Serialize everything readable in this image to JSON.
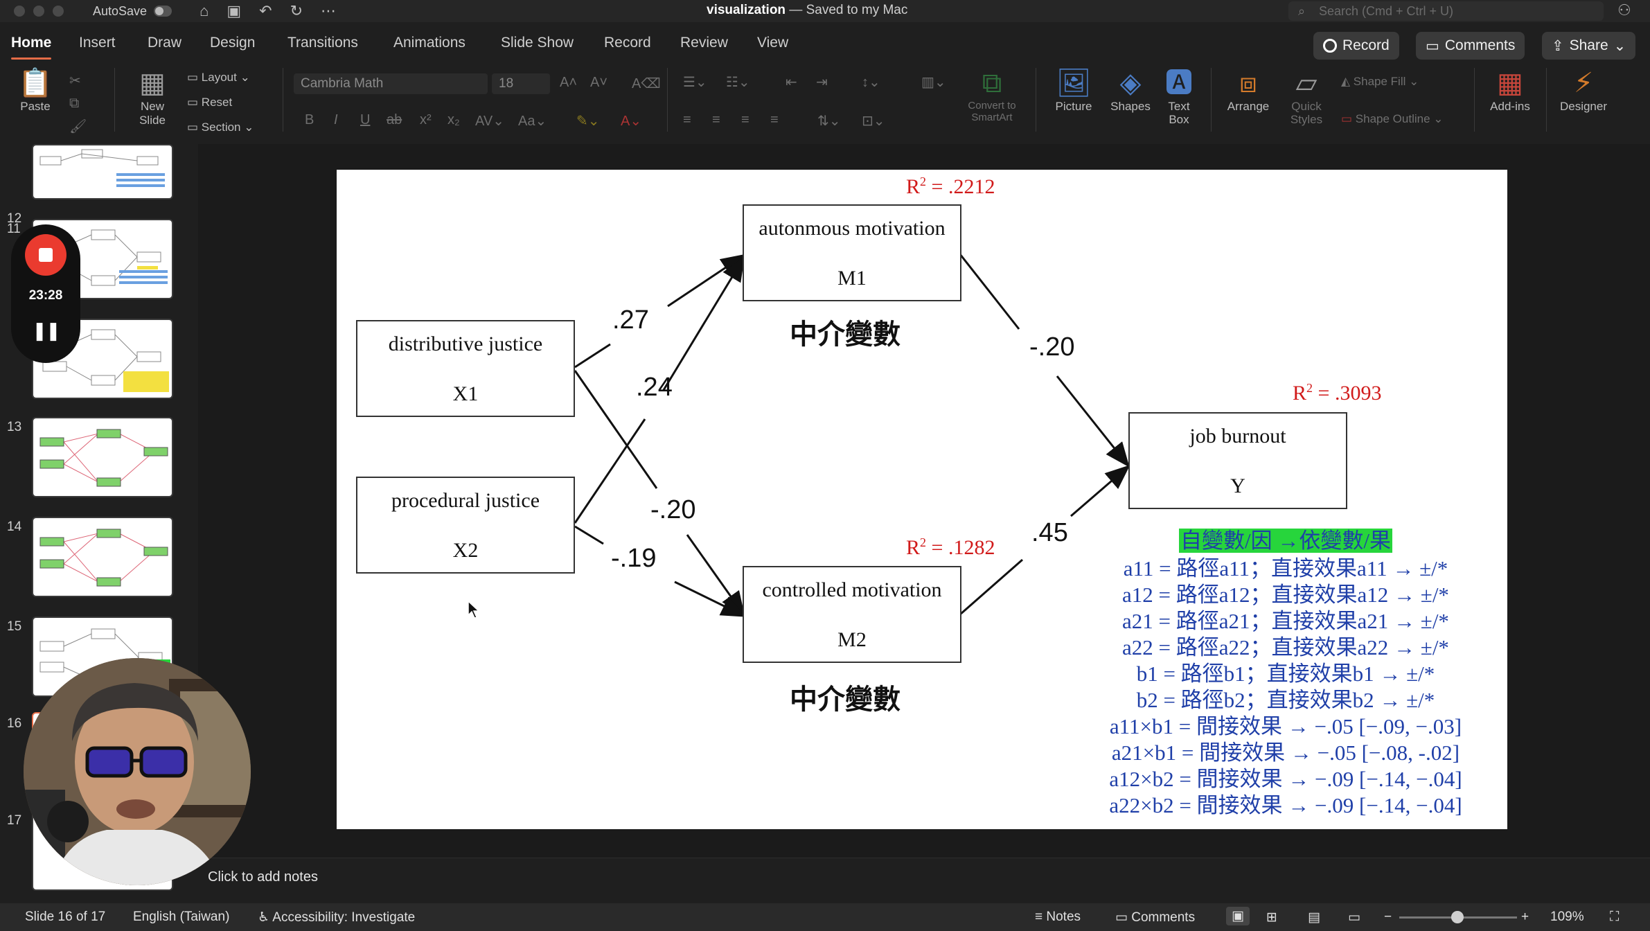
{
  "titlebar": {
    "autosave_label": "AutoSave",
    "doc_name": "visualization",
    "doc_status": "— Saved to my Mac",
    "search_placeholder": "Search (Cmd + Ctrl + U)"
  },
  "tabs": [
    "Home",
    "Insert",
    "Draw",
    "Design",
    "Transitions",
    "Animations",
    "Slide Show",
    "Record",
    "Review",
    "View"
  ],
  "actions": {
    "record": "Record",
    "comments": "Comments",
    "share": "Share"
  },
  "ribbon": {
    "paste": "Paste",
    "new_slide": "New Slide",
    "layout": "Layout",
    "reset": "Reset",
    "section": "Section",
    "font_name": "Cambria Math",
    "font_size": "18",
    "convert_smartart": "Convert to SmartArt",
    "picture": "Picture",
    "shapes": "Shapes",
    "text_box": "Text Box",
    "arrange": "Arrange",
    "quick_styles": "Quick Styles",
    "shape_fill": "Shape Fill",
    "shape_outline": "Shape Outline",
    "add_ins": "Add-ins",
    "designer": "Designer"
  },
  "thumbnails": [
    "11",
    "12",
    "13",
    "14",
    "15",
    "16",
    "17"
  ],
  "recording": {
    "elapsed": "23:28"
  },
  "slide": {
    "boxes": {
      "x1": {
        "label": "distributive justice",
        "var": "X1"
      },
      "x2": {
        "label": "procedural justice",
        "var": "X2"
      },
      "m1": {
        "label": "autonmous motivation",
        "var": "M1"
      },
      "m2": {
        "label": "controlled motivation",
        "var": "M2"
      },
      "y": {
        "label": "job burnout",
        "var": "Y"
      }
    },
    "coefficients": {
      "a11": ".27",
      "a21": ".24",
      "a12": "-.20",
      "a22": "-.19",
      "b1": "-.20",
      "b2": ".45"
    },
    "r2": {
      "m1": ".2212",
      "m2": ".1282",
      "y": ".3093"
    },
    "r2_prefix": "R",
    "r2_sup": "2",
    "r2_eq": " = ",
    "mediator_label": "中介變數",
    "legend": {
      "header": "自變數/因 →依變數/果",
      "lines": [
        "a11 = 路徑a11；直接效果a11 → ±/*",
        "a12 = 路徑a12；直接效果a12 → ±/*",
        "a21 = 路徑a21；直接效果a21 → ±/*",
        "a22 = 路徑a22；直接效果a22 → ±/*",
        "b1 = 路徑b1；直接效果b1 → ±/*",
        "b2 = 路徑b2；直接效果b2 → ±/*",
        "a11×b1 = 間接效果 → −.05 [−.09, −.03]",
        "a21×b1 = 間接效果 → −.05 [−.08, -.02]",
        "a12×b2 = 間接效果 → −.09 [−.14, −.04]",
        "a22×b2 = 間接效果 → −.09 [−.14, −.04]"
      ]
    }
  },
  "notes_placeholder": "Click to add notes",
  "statusbar": {
    "slide_pos": "Slide 16 of 17",
    "language": "English (Taiwan)",
    "accessibility": "Accessibility: Investigate",
    "notes": "Notes",
    "comments": "Comments",
    "zoom": "109%"
  }
}
